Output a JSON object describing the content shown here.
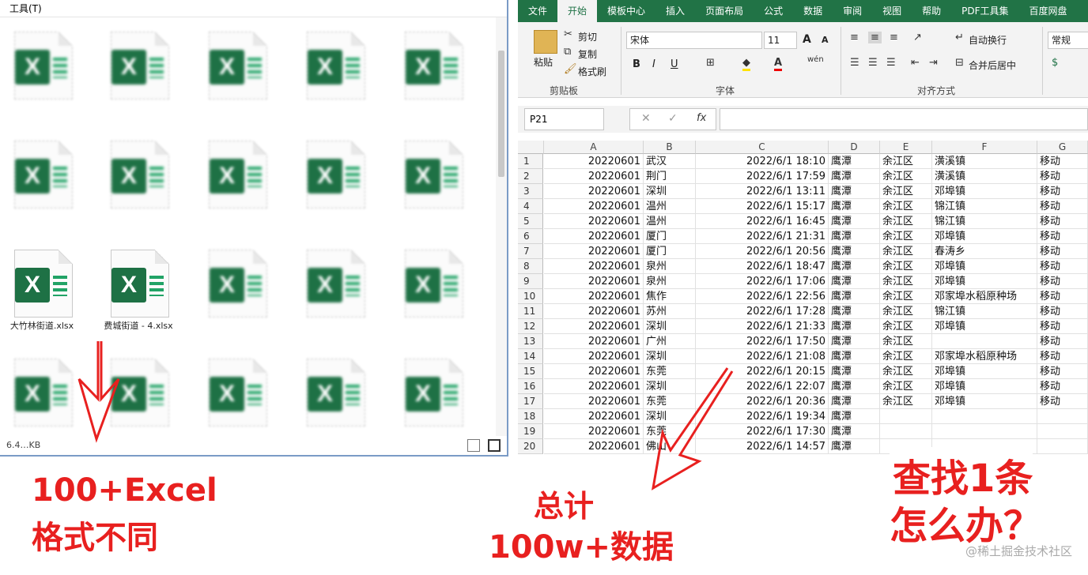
{
  "explorer": {
    "menu_tools": "工具(T)",
    "status_text": "6.4…KB",
    "files": [
      {
        "name": "",
        "blurred": true
      },
      {
        "name": "",
        "blurred": true
      },
      {
        "name": "",
        "blurred": true
      },
      {
        "name": "",
        "blurred": true
      },
      {
        "name": "",
        "blurred": true
      },
      {
        "name": "",
        "blurred": true
      },
      {
        "name": "",
        "blurred": true
      },
      {
        "name": "",
        "blurred": true
      },
      {
        "name": "",
        "blurred": true
      },
      {
        "name": "",
        "blurred": true
      },
      {
        "name": "大竹林街道.xlsx",
        "blurred": false
      },
      {
        "name": "费城街道 - 4.xlsx",
        "blurred": false
      },
      {
        "name": "",
        "blurred": true
      },
      {
        "name": "",
        "blurred": true
      },
      {
        "name": "",
        "blurred": true
      },
      {
        "name": "",
        "blurred": true
      },
      {
        "name": "",
        "blurred": true
      },
      {
        "name": "",
        "blurred": true
      },
      {
        "name": "",
        "blurred": true
      },
      {
        "name": "",
        "blurred": true
      }
    ],
    "file_icon": "excel-file-icon",
    "icon_letter": "X"
  },
  "excel": {
    "tabs": [
      "文件",
      "开始",
      "模板中心",
      "插入",
      "页面布局",
      "公式",
      "数据",
      "审阅",
      "视图",
      "帮助",
      "PDF工具集",
      "百度网盘"
    ],
    "active_tab": "开始",
    "clipboard": {
      "paste": "粘贴",
      "cut": "剪切",
      "copy": "复制",
      "format_painter": "格式刷",
      "label": "剪贴板"
    },
    "font": {
      "name": "宋体",
      "size": "11",
      "label": "字体",
      "bold": "B",
      "italic": "I",
      "underline": "U",
      "grow": "A",
      "shrink": "A"
    },
    "alignment": {
      "wrap": "自动换行",
      "merge": "合并后居中",
      "label": "对齐方式"
    },
    "number": {
      "format": "常规"
    },
    "name_box": "P21",
    "fx": "fx",
    "columns": [
      "A",
      "B",
      "C",
      "D",
      "E",
      "F",
      "G"
    ],
    "rows": [
      [
        "20220601",
        "武汉",
        "2022/6/1 18:10",
        "鹰潭",
        "余江区",
        "潢溪镇",
        "移动"
      ],
      [
        "20220601",
        "荆门",
        "2022/6/1 17:59",
        "鹰潭",
        "余江区",
        "潢溪镇",
        "移动"
      ],
      [
        "20220601",
        "深圳",
        "2022/6/1 13:11",
        "鹰潭",
        "余江区",
        "邓埠镇",
        "移动"
      ],
      [
        "20220601",
        "温州",
        "2022/6/1 15:17",
        "鹰潭",
        "余江区",
        "锦江镇",
        "移动"
      ],
      [
        "20220601",
        "温州",
        "2022/6/1 16:45",
        "鹰潭",
        "余江区",
        "锦江镇",
        "移动"
      ],
      [
        "20220601",
        "厦门",
        "2022/6/1 21:31",
        "鹰潭",
        "余江区",
        "邓埠镇",
        "移动"
      ],
      [
        "20220601",
        "厦门",
        "2022/6/1 20:56",
        "鹰潭",
        "余江区",
        "春涛乡",
        "移动"
      ],
      [
        "20220601",
        "泉州",
        "2022/6/1 18:47",
        "鹰潭",
        "余江区",
        "邓埠镇",
        "移动"
      ],
      [
        "20220601",
        "泉州",
        "2022/6/1 17:06",
        "鹰潭",
        "余江区",
        "邓埠镇",
        "移动"
      ],
      [
        "20220601",
        "焦作",
        "2022/6/1 22:56",
        "鹰潭",
        "余江区",
        "邓家埠水稻原种场",
        "移动"
      ],
      [
        "20220601",
        "苏州",
        "2022/6/1 17:28",
        "鹰潭",
        "余江区",
        "锦江镇",
        "移动"
      ],
      [
        "20220601",
        "深圳",
        "2022/6/1 21:33",
        "鹰潭",
        "余江区",
        "邓埠镇",
        "移动"
      ],
      [
        "20220601",
        "广州",
        "2022/6/1 17:50",
        "鹰潭",
        "余江区",
        "",
        "移动"
      ],
      [
        "20220601",
        "深圳",
        "2022/6/1 21:08",
        "鹰潭",
        "余江区",
        "邓家埠水稻原种场",
        "移动"
      ],
      [
        "20220601",
        "东莞",
        "2022/6/1 20:15",
        "鹰潭",
        "余江区",
        "邓埠镇",
        "移动"
      ],
      [
        "20220601",
        "深圳",
        "2022/6/1 22:07",
        "鹰潭",
        "余江区",
        "邓埠镇",
        "移动"
      ],
      [
        "20220601",
        "东莞",
        "2022/6/1 20:36",
        "鹰潭",
        "余江区",
        "邓埠镇",
        "移动"
      ],
      [
        "20220601",
        "深圳",
        "2022/6/1 19:34",
        "鹰潭",
        "",
        "",
        ""
      ],
      [
        "20220601",
        "东莞",
        "2022/6/1 17:30",
        "鹰潭",
        "",
        "",
        ""
      ],
      [
        "20220601",
        "佛山",
        "2022/6/1 14:57",
        "鹰潭",
        "",
        "",
        ""
      ]
    ]
  },
  "annotations": {
    "left_line1": "100+Excel",
    "left_line2": "格式不同",
    "middle_line1": "总计",
    "middle_line2": "100w+数据",
    "right_line1": "查找1条",
    "right_line2": "怎么办？",
    "watermark": "@稀土掘金技术社区",
    "color": "#e8201f"
  }
}
